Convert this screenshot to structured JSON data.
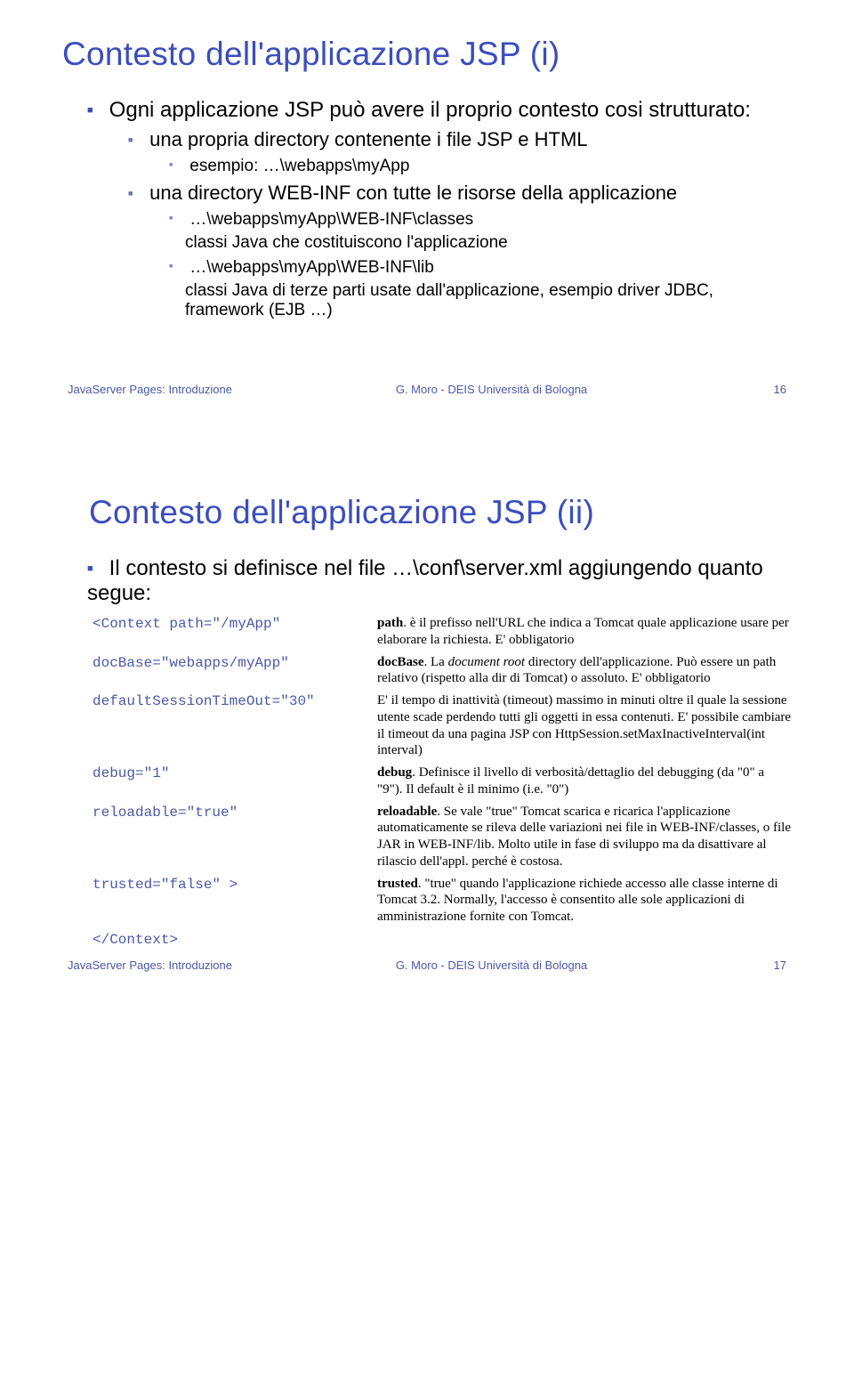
{
  "slide1": {
    "title": "Contesto dell'applicazione JSP (i)",
    "l1": "Ogni applicazione JSP può avere il proprio contesto cosi strutturato:",
    "l2a": "una propria directory contenente i file JSP e HTML",
    "l3a": "esempio: …\\webapps\\myApp",
    "l2b": "una directory WEB-INF con tutte le risorse della applicazione",
    "l3b": "…\\webapps\\myApp\\WEB-INF\\classes",
    "l3b_sub": "classi Java che costituiscono l'applicazione",
    "l3c": "…\\webapps\\myApp\\WEB-INF\\lib",
    "l3c_sub": "classi Java di terze parti usate dall'applicazione, esempio driver JDBC, framework (EJB …)",
    "footer_left": "JavaServer Pages: Introduzione",
    "footer_center": "G. Moro - DEIS Università di Bologna",
    "footer_right": "16"
  },
  "slide2": {
    "title": "Contesto dell'applicazione JSP (ii)",
    "intro": "Il contesto si definisce nel file …\\conf\\server.xml aggiungendo quanto segue:",
    "rows": {
      "r1_code": "<Context path=\"/myApp\"",
      "r1_desc_b": "path",
      "r1_desc": ". è il prefisso nell'URL che indica a Tomcat quale applicazione usare per elaborare la richiesta. E' obbligatorio",
      "r2_code": "docBase=\"webapps/myApp\"",
      "r2_desc_b": "docBase",
      "r2_desc": ". La ",
      "r2_desc_i": "document root",
      "r2_desc2": " directory dell'applicazione. Può essere un path relativo (rispetto alla dir di Tomcat) o assoluto. E' obbligatorio",
      "r3_code": "defaultSessionTimeOut=\"30\"",
      "r3_desc": "E' il tempo di inattività (timeout) massimo in minuti oltre il quale la sessione utente scade perdendo tutti gli oggetti in essa contenuti. E' possibile cambiare il timeout da una pagina JSP con HttpSession.setMaxInactiveInterval(int interval)",
      "r4_code": "debug=\"1\"",
      "r4_desc_b": "debug",
      "r4_desc": ". Definisce il livello di verbosità/dettaglio del debugging (da \"0\" a \"9\"). Il default è il minimo (i.e. \"0\")",
      "r5_code": "reloadable=\"true\"",
      "r5_desc_b": "reloadable",
      "r5_desc": ". Se vale \"true\" Tomcat scarica e ricarica l'applicazione automaticamente se rileva delle variazioni nei file in WEB-INF/classes, o file JAR in WEB-INF/lib. Molto utile in fase di sviluppo ma da disattivare al rilascio dell'appl. perché è costosa.",
      "r6_code": "trusted=\"false\" >",
      "r6_desc_b": "trusted",
      "r6_desc": ". \"true\" quando l'applicazione richiede accesso alle classe interne di Tomcat 3.2. Normally, l'accesso è consentito alle sole applicazioni di amministrazione fornite con Tomcat.",
      "r7_code": "</Context>"
    },
    "footer_left": "JavaServer Pages: Introduzione",
    "footer_center": "G. Moro - DEIS Università di Bologna",
    "footer_right": "17"
  }
}
